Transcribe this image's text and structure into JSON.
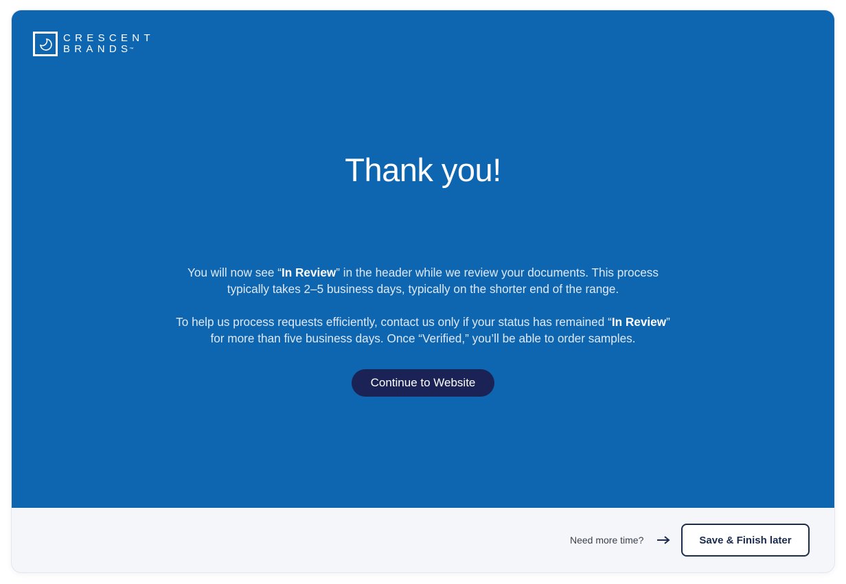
{
  "brand": {
    "logo_line1": "CRESCENT",
    "logo_line2": "BRANDS",
    "trademark": "™"
  },
  "main": {
    "title": "Thank you!",
    "paragraph1": {
      "pre": "You will now see “",
      "bold": "In Review",
      "post": "” in the header while we review your documents. This process typically takes 2–5 business days, typically on the shorter end of the range."
    },
    "paragraph2": {
      "pre": "To help us process requests efficiently, contact us only if your status has remained “",
      "bold": "In Review",
      "post": "” for more than five business days. Once “Verified,” you’ll be able to order samples."
    },
    "cta_label": "Continue to Website"
  },
  "footer": {
    "note": "Need more time?",
    "save_label": "Save & Finish later"
  },
  "colors": {
    "hero_background": "#0e65b0",
    "cta_background": "#1b2356",
    "footer_background": "#f5f6fa",
    "save_border": "#1a2b4c"
  },
  "icons": {
    "logo": "crescent-moon-logo-icon",
    "arrow": "arrow-right-icon"
  }
}
